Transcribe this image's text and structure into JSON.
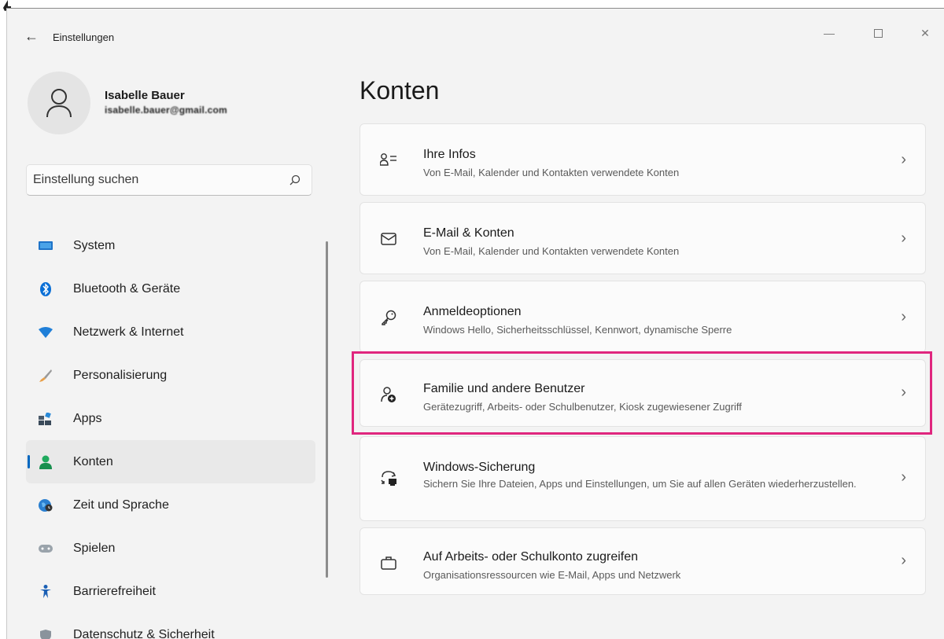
{
  "window": {
    "title": "Einstellungen"
  },
  "profile": {
    "name": "Isabelle Bauer",
    "email": "isabelle.bauer@gmail.com"
  },
  "search": {
    "placeholder": "Einstellung suchen"
  },
  "nav": {
    "items": [
      {
        "label": "System",
        "icon": "system-icon"
      },
      {
        "label": "Bluetooth & Geräte",
        "icon": "bluetooth-icon"
      },
      {
        "label": "Netzwerk & Internet",
        "icon": "wifi-icon"
      },
      {
        "label": "Personalisierung",
        "icon": "brush-icon"
      },
      {
        "label": "Apps",
        "icon": "apps-icon"
      },
      {
        "label": "Konten",
        "icon": "accounts-icon",
        "active": true
      },
      {
        "label": "Zeit und Sprache",
        "icon": "globe-clock-icon"
      },
      {
        "label": "Spielen",
        "icon": "gamepad-icon"
      },
      {
        "label": "Barrierefreiheit",
        "icon": "accessibility-icon"
      },
      {
        "label": "Datenschutz & Sicherheit",
        "icon": "shield-icon"
      }
    ]
  },
  "main": {
    "title": "Konten",
    "cards": [
      {
        "title": "Ihre Infos",
        "subtitle": "Von E-Mail, Kalender und Kontakten verwendete Konten",
        "icon": "person-info-icon"
      },
      {
        "title": "E-Mail & Konten",
        "subtitle": "Von E-Mail, Kalender und Kontakten verwendete Konten",
        "icon": "mail-icon"
      },
      {
        "title": "Anmeldeoptionen",
        "subtitle": "Windows Hello, Sicherheitsschlüssel, Kennwort, dynamische Sperre",
        "icon": "key-icon"
      },
      {
        "title": "Familie und andere Benutzer",
        "subtitle": "Gerätezugriff, Arbeits- oder Schulbenutzer, Kiosk zugewiesener Zugriff",
        "icon": "add-person-icon",
        "highlighted": true
      },
      {
        "title": "Windows-Sicherung",
        "subtitle": "Sichern Sie Ihre Dateien, Apps und Einstellungen, um Sie auf allen Geräten wiederherzustellen.",
        "icon": "backup-icon"
      },
      {
        "title": "Auf Arbeits- oder Schulkonto zugreifen",
        "subtitle": "Organisationsressourcen wie E-Mail, Apps und Netzwerk",
        "icon": "briefcase-icon"
      }
    ]
  },
  "colors": {
    "accent": "#0067c0",
    "highlight": "#e0267e",
    "background": "#f3f3f3"
  }
}
